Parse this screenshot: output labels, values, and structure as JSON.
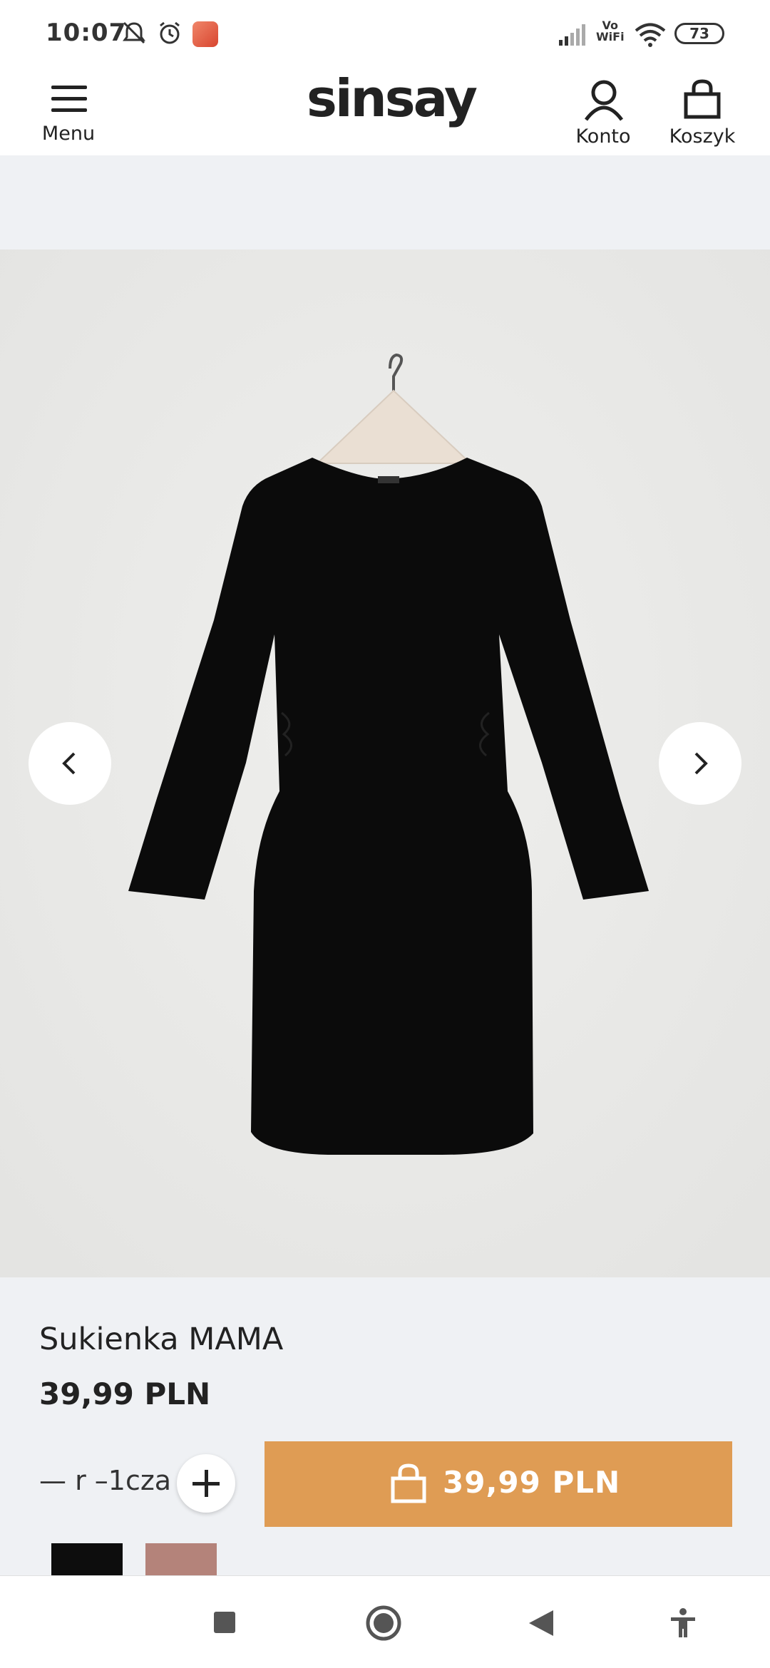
{
  "status_bar": {
    "time": "10:07",
    "battery": "73",
    "vowifi_top": "Vo",
    "vowifi_bottom": "WiFi",
    "icons": [
      "mute-icon",
      "alarm-icon",
      "app-notification-icon",
      "signal-icon",
      "wifi-icon",
      "battery-icon"
    ]
  },
  "header": {
    "menu_label": "Menu",
    "logo": "sinsay",
    "account_label": "Konto",
    "cart_label": "Koszyk"
  },
  "product": {
    "title": "Sukienka MAMA",
    "price": "39,99 PLN",
    "size_text_fragment": "— r –1cza",
    "add_to_cart_price": "39,99 PLN",
    "color_swatches": [
      "#0d0d0d",
      "#b4837a"
    ]
  },
  "gallery": {
    "background": "#e9e9e7",
    "prev_icon": "chevron-left-icon",
    "next_icon": "chevron-right-icon"
  },
  "colors": {
    "accent": "#df9c54",
    "background": "#eff1f4"
  },
  "system_nav": [
    "recents-icon",
    "home-icon",
    "back-icon",
    "accessibility-icon"
  ]
}
